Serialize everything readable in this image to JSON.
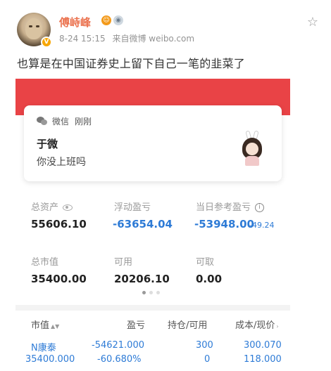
{
  "post": {
    "user_name": "傅峙峰",
    "badge_1": "V",
    "date": "8-24 15:15",
    "source": "来自微博 weibo.com",
    "text": "也算是在中国证券史上留下自己一笔的韭菜了"
  },
  "notification": {
    "app": "微信",
    "time": "刚刚",
    "sender": "于微",
    "message": "你没上班吗"
  },
  "account": {
    "total_assets_label": "总资产",
    "total_assets": "55606.10",
    "floating_pl_label": "浮动盈亏",
    "floating_pl": "-63654.04",
    "daily_pl_label": "当日参考盈亏",
    "daily_pl": "-53948.00",
    "daily_pl_pct": "-49.24",
    "market_value_label": "总市值",
    "market_value": "35400.00",
    "available_label": "可用",
    "available": "20206.10",
    "withdrawable_label": "可取",
    "withdrawable": "0.00"
  },
  "table": {
    "headers": [
      "市值",
      "盈亏",
      "持仓/可用",
      "成本/现价"
    ],
    "rows": [
      {
        "name": "N康泰",
        "market_value": "35400.000",
        "pl": "-54621.000",
        "pl_pct": "-60.680%",
        "position": "300",
        "available": "0",
        "cost": "300.070",
        "price": "118.000"
      }
    ]
  },
  "colors": {
    "accent_red": "#e94346",
    "loss_blue": "#2e7bd6",
    "weibo_name": "#eb7350"
  }
}
